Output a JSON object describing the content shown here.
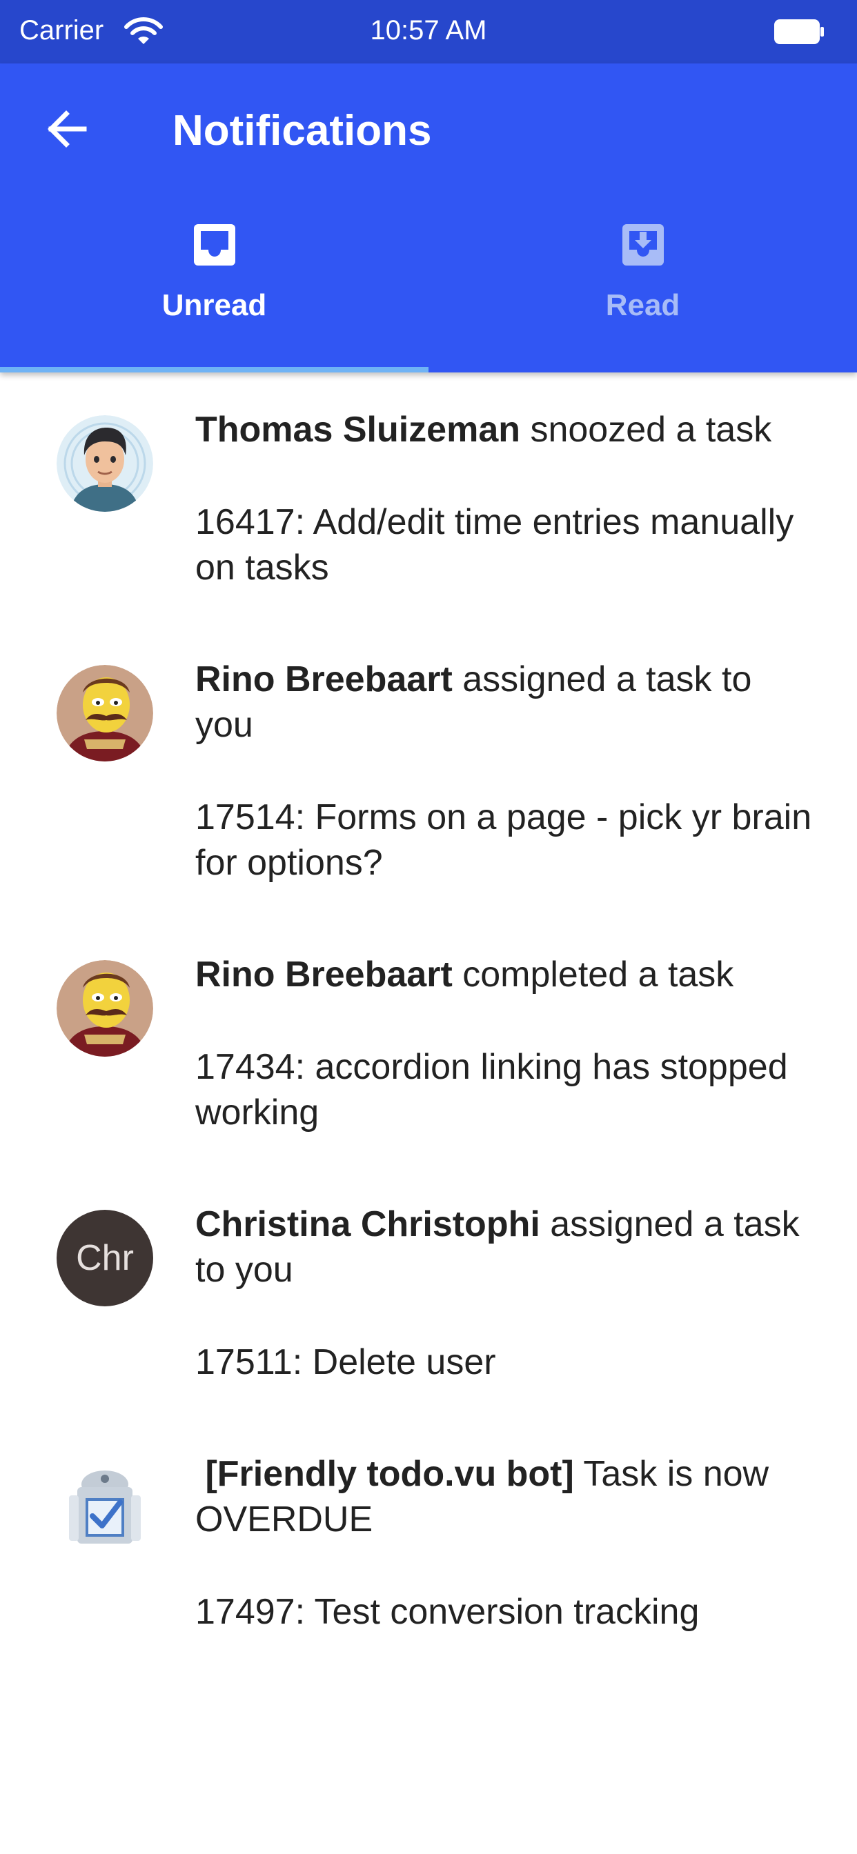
{
  "status_bar": {
    "carrier": "Carrier",
    "time": "10:57 AM"
  },
  "header": {
    "title": "Notifications"
  },
  "tabs": [
    {
      "label": "Unread",
      "icon": "inbox-icon",
      "selected": true
    },
    {
      "label": "Read",
      "icon": "archive-download-icon",
      "selected": false
    }
  ],
  "colors": {
    "status_bar": "#2747cc",
    "app_bar": "#3156f3",
    "tab_indicator": "#6fb3f5",
    "inactive_tab": "#a8bcf7"
  },
  "notifications": [
    {
      "actor": "Thomas Sluizeman",
      "action": " snoozed a task",
      "task": "16417: Add/edit time entries manually on tasks",
      "avatar": "cartoon-man-avatar"
    },
    {
      "actor": "Rino Breebaart",
      "action": " assigned a task to you",
      "task": "17514: Forms on a page - pick yr brain for options?",
      "avatar": "cartoon-mustache-avatar"
    },
    {
      "actor": "Rino Breebaart",
      "action": " completed a task",
      "task": "17434: accordion linking has stopped working",
      "avatar": "cartoon-mustache-avatar"
    },
    {
      "actor": "Christina Christophi",
      "action": " assigned a task to you",
      "task": "17511: Delete user",
      "avatar": "initials-avatar",
      "initials": "Chr"
    },
    {
      "actor": " [Friendly todo.vu bot]",
      "action": " Task is now OVERDUE",
      "task": "17497: Test conversion tracking",
      "avatar": "robot-avatar"
    }
  ]
}
